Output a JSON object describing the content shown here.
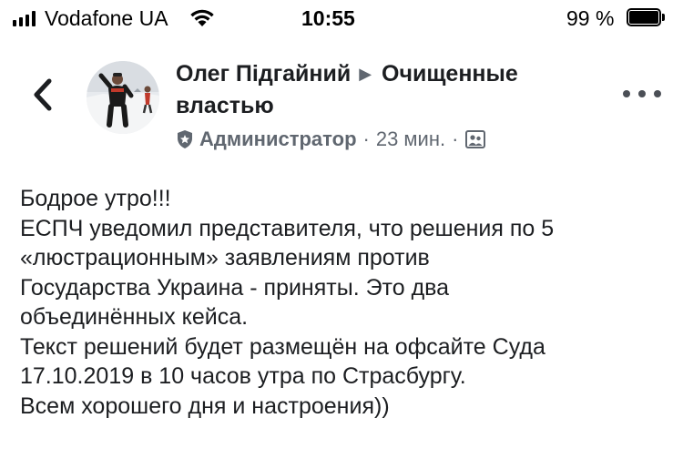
{
  "status_bar": {
    "carrier": "Vodafone UA",
    "time": "10:55",
    "battery_percent": "99 %",
    "battery_level": 0.99
  },
  "header": {
    "author": "Олег Підгайний",
    "group_line1": "Очищенные",
    "group_line2": "властью",
    "role": "Администратор",
    "time_ago": "23 мин.",
    "separator": "·"
  },
  "post": {
    "lines": [
      "Бодрое утро!!!",
      "ЕСПЧ уведомил представителя, что решения по 5",
      "«люстрационным» заявлениям против",
      "Государства Украина - приняты. Это два",
      "объединённых кейса.",
      "Текст решений будет размещён на офсайте Суда",
      "17.10.2019 в 10 часов утра по Страсбургу.",
      "Всем хорошего дня и настроения))"
    ]
  },
  "icons": {
    "back": "chevron-left-icon",
    "more": "more-horizontal-icon",
    "role": "admin-shield-icon",
    "audience": "group-audience-icon",
    "wifi": "wifi-icon",
    "battery": "battery-icon",
    "signal": "signal-bars-icon"
  },
  "colors": {
    "text": "#1c1e21",
    "secondary": "#606770",
    "icon": "#4b4f56"
  }
}
